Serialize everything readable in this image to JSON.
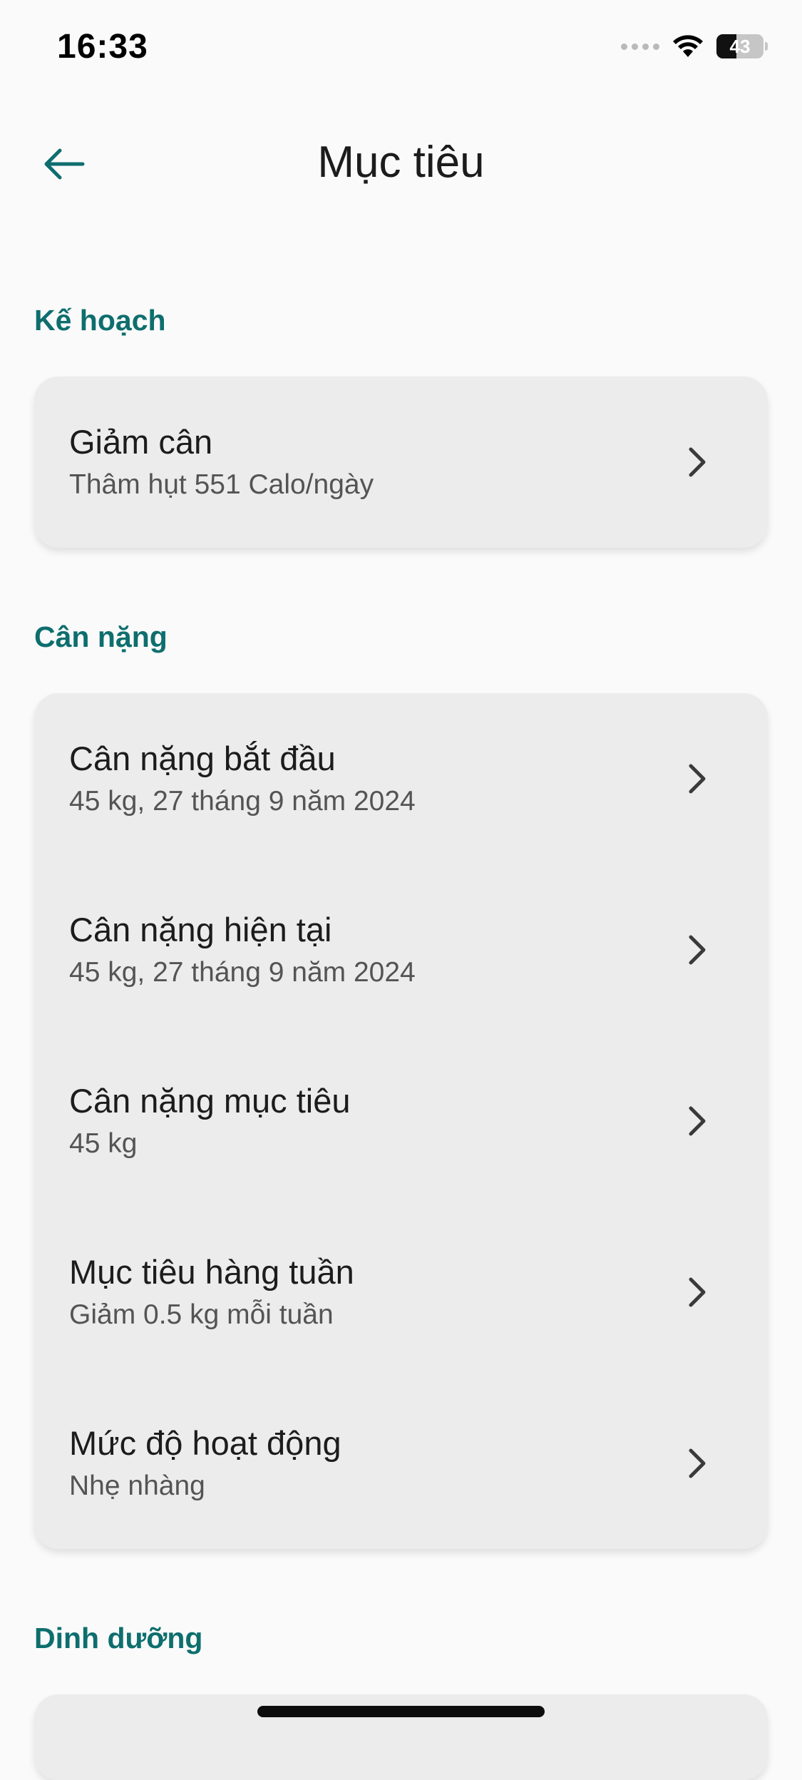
{
  "status_bar": {
    "time": "16:33",
    "battery_level": "43",
    "battery_fraction": 0.43,
    "icons": [
      "cellular-signal-icon",
      "wifi-icon",
      "battery-icon"
    ]
  },
  "header": {
    "title": "Mục tiêu",
    "back_icon": "arrow-left-icon"
  },
  "sections": {
    "plan": {
      "label": "Kế hoạch",
      "items": [
        {
          "title": "Giảm cân",
          "subtitle": "Thâm hụt 551 Calo/ngày"
        }
      ]
    },
    "weight": {
      "label": "Cân nặng",
      "items": [
        {
          "title": "Cân nặng bắt đầu",
          "subtitle": "45 kg, 27 tháng 9 năm 2024"
        },
        {
          "title": "Cân nặng hiện tại",
          "subtitle": "45 kg, 27 tháng 9 năm 2024"
        },
        {
          "title": "Cân nặng mục tiêu",
          "subtitle": "45 kg"
        },
        {
          "title": "Mục tiêu hàng tuần",
          "subtitle": "Giảm 0.5 kg mỗi tuần"
        },
        {
          "title": "Mức độ hoạt động",
          "subtitle": "Nhẹ nhàng"
        }
      ]
    },
    "nutrition": {
      "label": "Dinh dưỡng"
    }
  },
  "colors": {
    "accent": "#0e6e6e",
    "card_background": "#ececec",
    "page_background": "#fafafa"
  }
}
